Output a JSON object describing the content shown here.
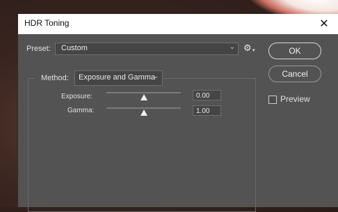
{
  "window": {
    "title": "HDR Toning"
  },
  "preset": {
    "label": "Preset:",
    "value": "Custom"
  },
  "buttons": {
    "ok": "OK",
    "cancel": "Cancel"
  },
  "preview": {
    "label": "Preview",
    "checked": false
  },
  "method": {
    "label": "Method:",
    "value": "Exposure and Gamma"
  },
  "sliders": [
    {
      "label": "Exposure:",
      "value": "0.00",
      "fraction": 0.5
    },
    {
      "label": "Gamma:",
      "value": "1.00",
      "fraction": 0.5
    }
  ],
  "icons": {
    "close": "close-icon",
    "gear": "gear-icon",
    "dropdown": "chevron-down-icon"
  }
}
